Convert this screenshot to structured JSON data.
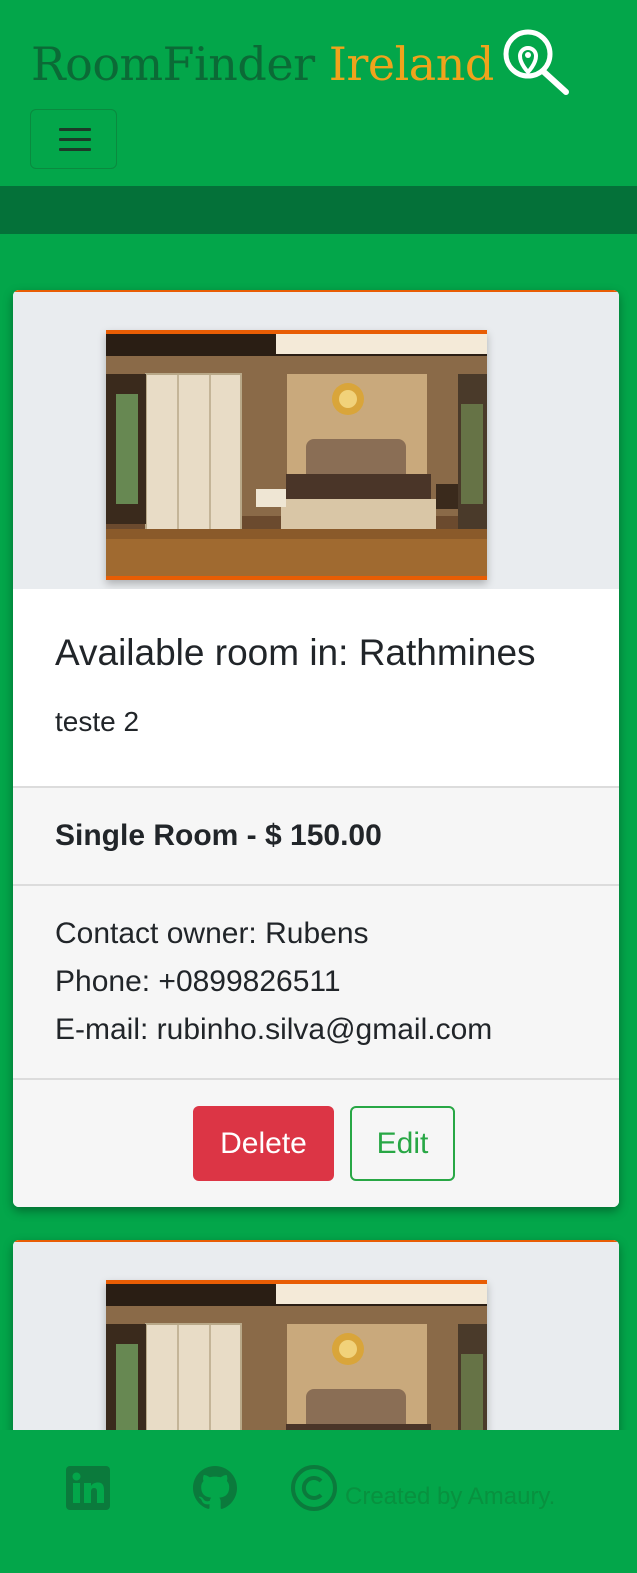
{
  "header": {
    "brand_part1": "RoomFinder",
    "brand_part2": "Ireland",
    "logo_icon": "location-search-icon",
    "menu_icon": "hamburger-menu-icon"
  },
  "listings": [
    {
      "image": "bedroom-photo",
      "title": "Available room in: Rathmines",
      "description": "teste 2",
      "price": "Single Room - $ 150.00",
      "contact_owner": "Contact owner: Rubens",
      "phone": "Phone: +0899826511",
      "email": "E-mail: rubinho.silva@gmail.com",
      "delete_label": "Delete",
      "edit_label": "Edit"
    },
    {
      "image": "bedroom-photo"
    }
  ],
  "footer": {
    "icons": [
      "linkedin-icon",
      "github-icon",
      "copyright-icon"
    ],
    "credit": "Created by Amaury."
  },
  "colors": {
    "primary_green": "#03a64a",
    "dark_green": "#047139",
    "accent_orange": "#e85d04",
    "brand_gold": "#f0a31c",
    "delete_red": "#dc3545",
    "edit_green": "#28a745"
  }
}
